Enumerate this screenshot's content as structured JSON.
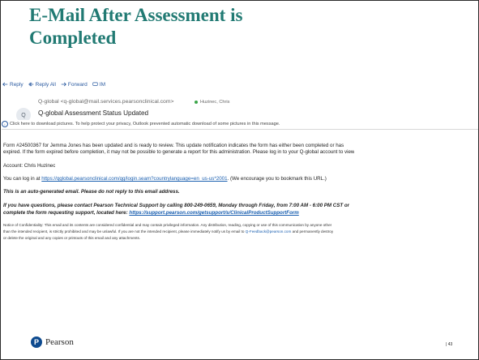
{
  "slide": {
    "title_line1": "E-Mail After Assessment is",
    "title_line2": "Completed",
    "page_number": "43"
  },
  "email": {
    "toolbar": {
      "reply": "Reply",
      "reply_all": "Reply All",
      "forward": "Forward",
      "im": "IM"
    },
    "avatar_initial": "Q",
    "from": "Q-global <q-global@mail.services.pearsonclinical.com>",
    "to": "Huzinec, Chris",
    "subject": "Q-global Assessment Status Updated",
    "info_bar": "Click here to download pictures. To help protect your privacy, Outlook prevented automatic download of some pictures in this message.",
    "body": {
      "form_line1": "Form #24500367 for Jemma Jones has been updated and is ready to review.  This update notification indicates the form has either been completed or has",
      "form_line2": "expired.  If the form expired before completion, it may not be possible to generate a report for this administration.  Please log in to your Q-global account to view",
      "account_line": "Account: Chris Huzinec",
      "login_prefix": "You can log in at",
      "login_link": "https://qglobal.pearsonclinical.com/qg/login.seam?countrylanguage=en_us-us*2001",
      "login_suffix": ". (We encourage you to bookmark this URL.)",
      "auto_generated": "This is an auto-generated email. Please do not reply to this email address.",
      "support_line1": "If you have questions, please contact Pearson Technical Support by calling 800-249-0659, Monday through Friday, from 7:00 AM - 6:00 PM CST or",
      "support_prefix": "complete the form requesting support, located here:",
      "support_link": "https://support.pearson.com/getsupport/s/ClinicalProductSupportForm",
      "notice_line1": "Notice of Confidentiality: This email and its contents are considered confidential and may contain privileged information. Any distribution, reading, copying or use of this communication by anyone other",
      "notice_line2_prefix": "than the intended recipient, is strictly prohibited and may be unlawful. If you are not the intended recipient, please immediately notify us by email to",
      "notice_email": "Q-Feedback@pearson.com",
      "notice_line2_suffix": "and permanently destroy",
      "notice_line3": "or delete the original and any copies or printouts of this email and any attachments."
    }
  },
  "footer": {
    "brand": "Pearson",
    "logo_letter": "P"
  }
}
